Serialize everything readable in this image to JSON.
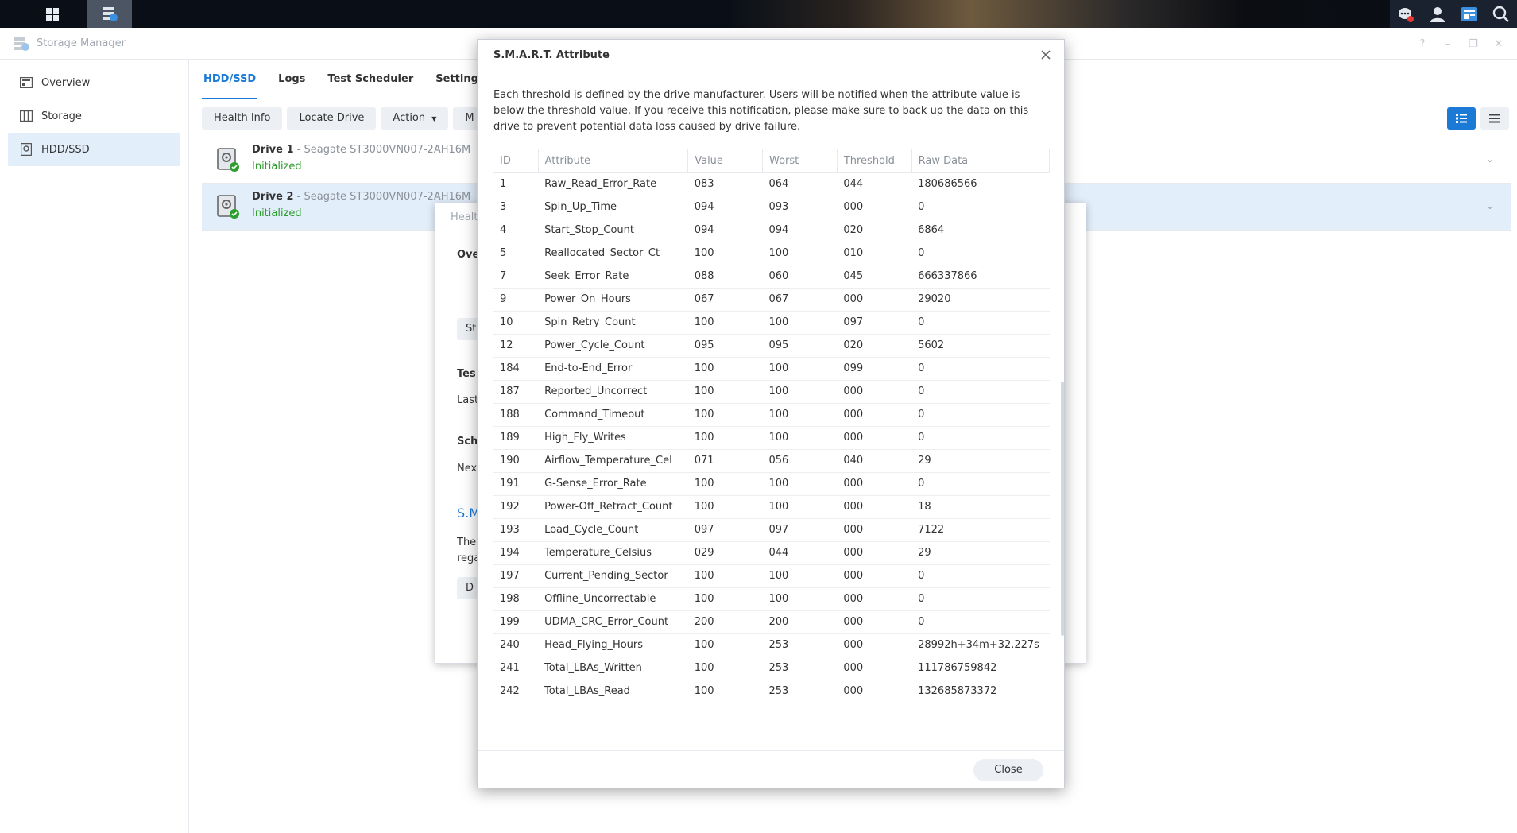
{
  "app": {
    "title": "Storage Manager",
    "window_controls": [
      "?",
      "–",
      "❐",
      "✕"
    ]
  },
  "sidebar": {
    "items": [
      {
        "label": "Overview"
      },
      {
        "label": "Storage"
      },
      {
        "label": "HDD/SSD"
      }
    ]
  },
  "tabs": [
    "HDD/SSD",
    "Logs",
    "Test Scheduler",
    "Settings"
  ],
  "toolbar": {
    "health_info": "Health Info",
    "locate_drive": "Locate Drive",
    "action": "Action",
    "more": "M"
  },
  "drives": [
    {
      "name": "Drive 1",
      "model": " - Seagate ST3000VN007-2AH16M",
      "status": "Initialized"
    },
    {
      "name": "Drive 2",
      "model": " - Seagate ST3000VN007-2AH16M",
      "status": "Initialized"
    }
  ],
  "health_dialog": {
    "title_fragment": "Healt",
    "overview_fragment": "Ove",
    "btn1_fragment": "St",
    "test_fragment": "Tes",
    "last_fragment": "Last",
    "schedule_fragment": "Sch",
    "next_fragment": "Nex",
    "smart_fragment": "S.M",
    "desc_fragment1": "The",
    "desc_fragment2": "rega",
    "btn2_fragment": "D"
  },
  "smart_dialog": {
    "title": "S.M.A.R.T. Attribute",
    "description": "Each threshold is defined by the drive manufacturer. Users will be notified when the attribute value is below the threshold value. If you receive this notification, please make sure to back up the data on this drive to prevent potential data loss caused by drive failure.",
    "columns": [
      "ID",
      "Attribute",
      "Value",
      "Worst",
      "Threshold",
      "Raw Data"
    ],
    "rows": [
      [
        "1",
        "Raw_Read_Error_Rate",
        "083",
        "064",
        "044",
        "180686566"
      ],
      [
        "3",
        "Spin_Up_Time",
        "094",
        "093",
        "000",
        "0"
      ],
      [
        "4",
        "Start_Stop_Count",
        "094",
        "094",
        "020",
        "6864"
      ],
      [
        "5",
        "Reallocated_Sector_Ct",
        "100",
        "100",
        "010",
        "0"
      ],
      [
        "7",
        "Seek_Error_Rate",
        "088",
        "060",
        "045",
        "666337866"
      ],
      [
        "9",
        "Power_On_Hours",
        "067",
        "067",
        "000",
        "29020"
      ],
      [
        "10",
        "Spin_Retry_Count",
        "100",
        "100",
        "097",
        "0"
      ],
      [
        "12",
        "Power_Cycle_Count",
        "095",
        "095",
        "020",
        "5602"
      ],
      [
        "184",
        "End-to-End_Error",
        "100",
        "100",
        "099",
        "0"
      ],
      [
        "187",
        "Reported_Uncorrect",
        "100",
        "100",
        "000",
        "0"
      ],
      [
        "188",
        "Command_Timeout",
        "100",
        "100",
        "000",
        "0"
      ],
      [
        "189",
        "High_Fly_Writes",
        "100",
        "100",
        "000",
        "0"
      ],
      [
        "190",
        "Airflow_Temperature_Cel",
        "071",
        "056",
        "040",
        "29"
      ],
      [
        "191",
        "G-Sense_Error_Rate",
        "100",
        "100",
        "000",
        "0"
      ],
      [
        "192",
        "Power-Off_Retract_Count",
        "100",
        "100",
        "000",
        "18"
      ],
      [
        "193",
        "Load_Cycle_Count",
        "097",
        "097",
        "000",
        "7122"
      ],
      [
        "194",
        "Temperature_Celsius",
        "029",
        "044",
        "000",
        "29"
      ],
      [
        "197",
        "Current_Pending_Sector",
        "100",
        "100",
        "000",
        "0"
      ],
      [
        "198",
        "Offline_Uncorrectable",
        "100",
        "100",
        "000",
        "0"
      ],
      [
        "199",
        "UDMA_CRC_Error_Count",
        "200",
        "200",
        "000",
        "0"
      ],
      [
        "240",
        "Head_Flying_Hours",
        "100",
        "253",
        "000",
        "28992h+34m+32.227s"
      ],
      [
        "241",
        "Total_LBAs_Written",
        "100",
        "253",
        "000",
        "111786759842"
      ],
      [
        "242",
        "Total_LBAs_Read",
        "100",
        "253",
        "000",
        "132685873372"
      ]
    ],
    "close_label": "Close"
  },
  "colors": {
    "accent": "#1a7ad6",
    "success": "#2c9e2c",
    "selected_bg": "#e3eefb"
  }
}
